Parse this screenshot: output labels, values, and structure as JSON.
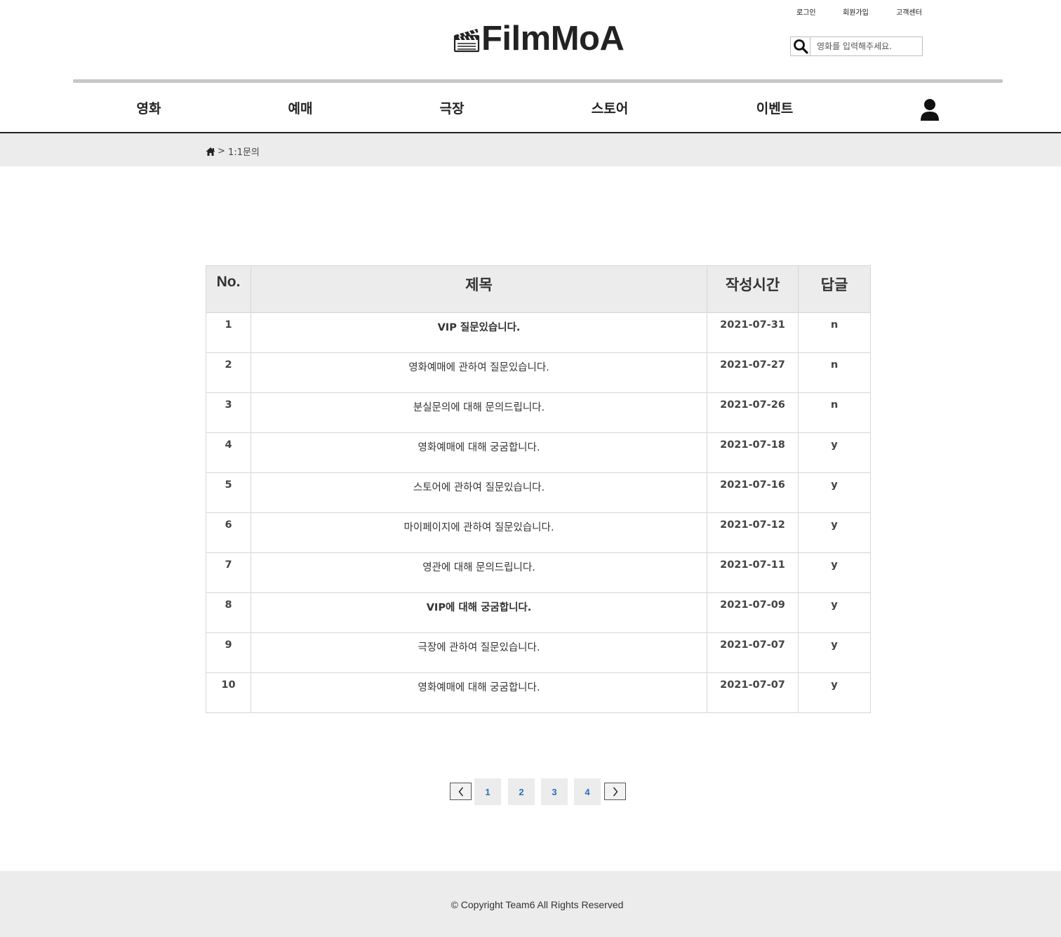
{
  "header": {
    "util_links": [
      "로그인",
      "회원가입",
      "고객센터"
    ],
    "logo_text": "FilmMoA",
    "search": {
      "placeholder": "영화를 입력해주세요."
    }
  },
  "nav": {
    "items": [
      "영화",
      "예매",
      "극장",
      "스토어",
      "이벤트"
    ]
  },
  "breadcrumb": {
    "separator": ">",
    "current": "1:1문의"
  },
  "board": {
    "columns": [
      "No.",
      "제목",
      "작성시간",
      "답글"
    ],
    "rows": [
      {
        "no": "1",
        "title": "VIP 질문있습니다.",
        "date": "2021-07-31",
        "reply": "n"
      },
      {
        "no": "2",
        "title": "영화예매에 관하여 질문있습니다.",
        "date": "2021-07-27",
        "reply": "n"
      },
      {
        "no": "3",
        "title": "분실문의에 대해 문의드립니다.",
        "date": "2021-07-26",
        "reply": "n"
      },
      {
        "no": "4",
        "title": "영화예매에 대해 궁굼합니다.",
        "date": "2021-07-18",
        "reply": "y"
      },
      {
        "no": "5",
        "title": "스토어에 관하여 질문있습니다.",
        "date": "2021-07-16",
        "reply": "y"
      },
      {
        "no": "6",
        "title": "마이페이지에 관하여 질문있습니다.",
        "date": "2021-07-12",
        "reply": "y"
      },
      {
        "no": "7",
        "title": "영관에 대해 문의드립니다.",
        "date": "2021-07-11",
        "reply": "y"
      },
      {
        "no": "8",
        "title": "VIP에 대해 궁굼합니다.",
        "date": "2021-07-09",
        "reply": "y"
      },
      {
        "no": "9",
        "title": "극장에 관하여 질문있습니다.",
        "date": "2021-07-07",
        "reply": "y"
      },
      {
        "no": "10",
        "title": "영화예매에 대해 궁굼합니다.",
        "date": "2021-07-07",
        "reply": "y"
      }
    ]
  },
  "pagination": {
    "pages": [
      "1",
      "2",
      "3",
      "4"
    ],
    "icons": {
      "prev": "chevron-left-icon",
      "next": "chevron-right-icon"
    }
  },
  "footer": {
    "copyright": "© Copyright Team6 All Rights Reserved"
  },
  "icons": {
    "logo": "clapperboard-icon",
    "search": "search-icon",
    "user": "user-icon",
    "home": "home-icon"
  },
  "colors": {
    "page_link": "#2a6ebb",
    "header_bg": "#ececec",
    "nav_line": "#222222"
  }
}
